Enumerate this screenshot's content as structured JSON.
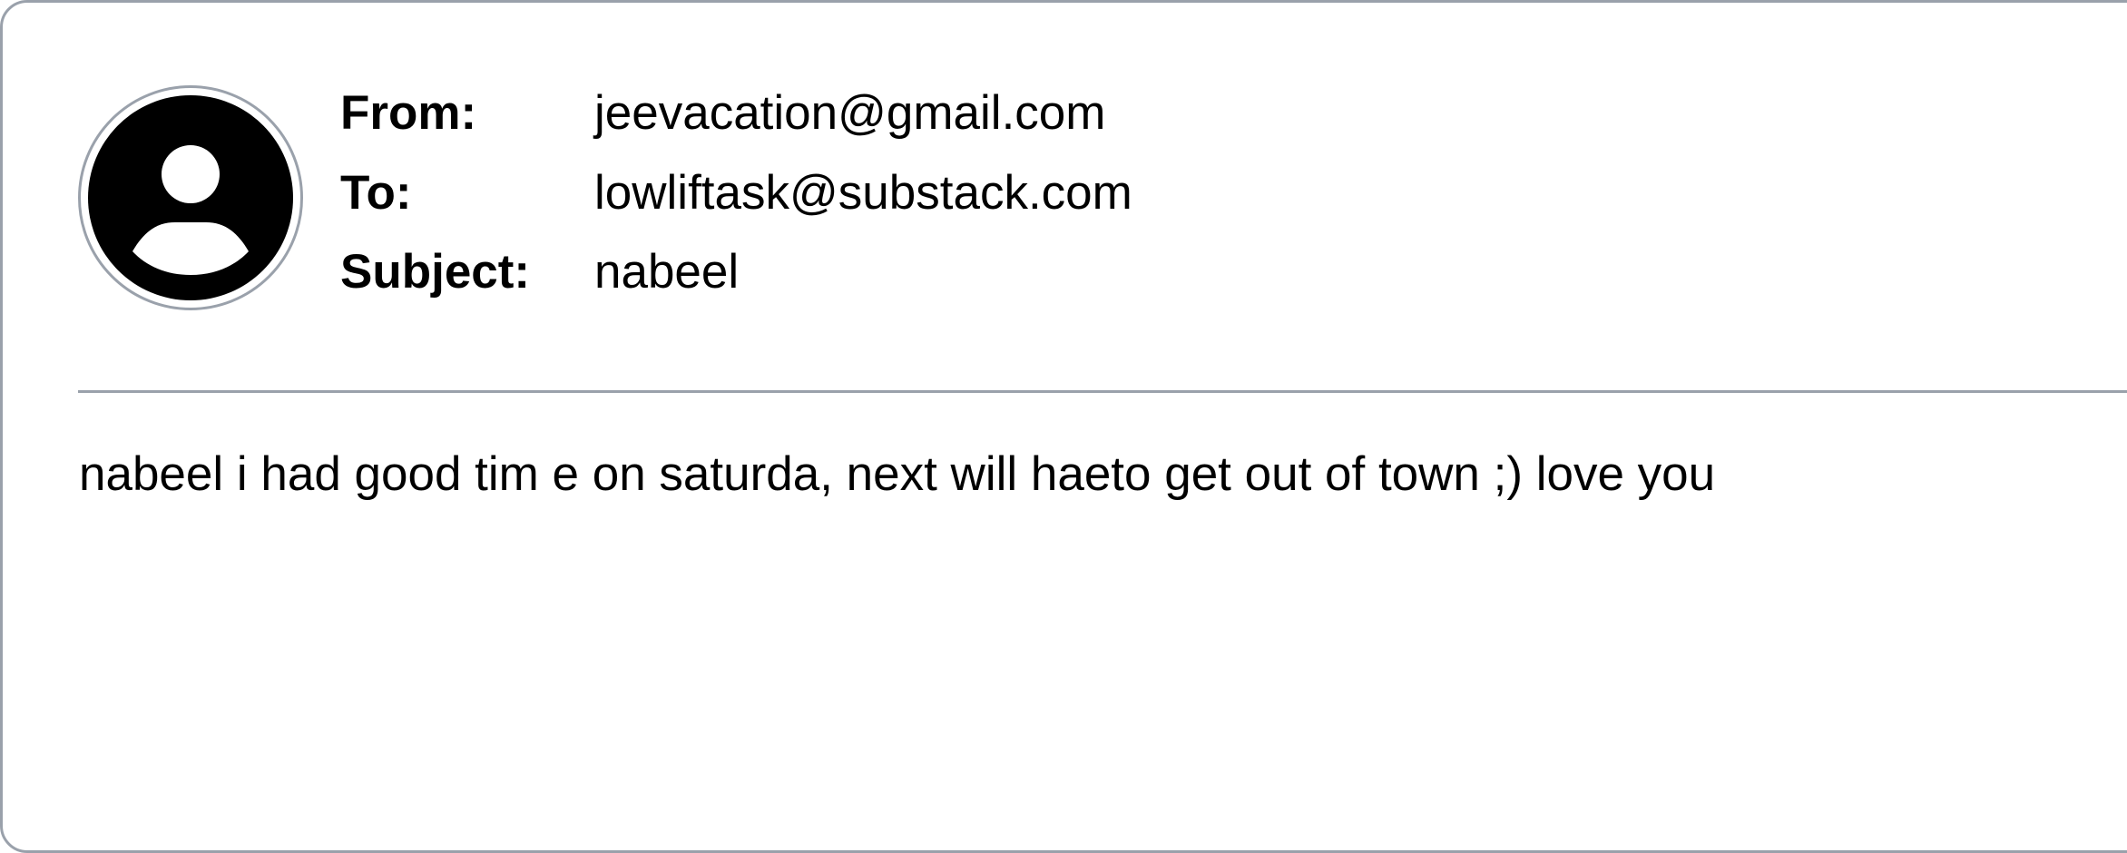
{
  "header": {
    "avatar_icon": "user-avatar-icon",
    "from_label": "From:",
    "from_value": "jeevacation@gmail.com",
    "to_label": "To:",
    "to_value": "lowliftask@substack.com",
    "subject_label": "Subject:",
    "subject_value": "nabeel"
  },
  "message": {
    "body": "nabeel i had good tim e on saturda, next will haeto get out of town ;) love you"
  },
  "colors": {
    "border": "#9aa1ab",
    "text": "#000000",
    "background": "#ffffff"
  }
}
